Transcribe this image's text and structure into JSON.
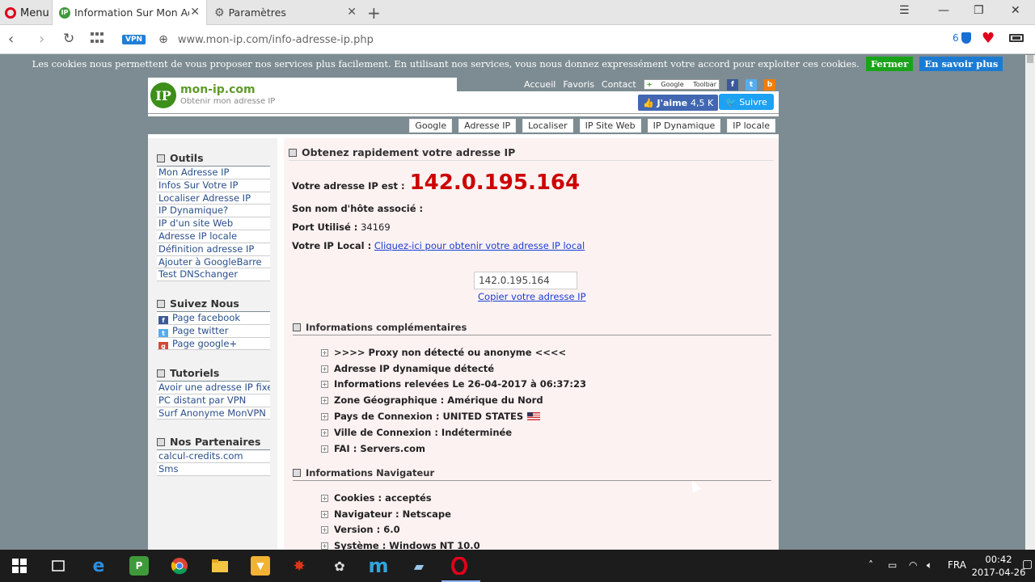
{
  "browser": {
    "menu_label": "Menu",
    "tabs": [
      {
        "title": "Information Sur Mon Adresse",
        "favicon": "IP"
      },
      {
        "title": "Paramètres",
        "favicon": "gear-icon"
      }
    ],
    "vpn_label": "VPN",
    "url": "www.mon-ip.com/info-adresse-ip.php",
    "adblock_count": "6"
  },
  "cookie_banner": {
    "text": "Les cookies nous permettent de vous proposer nos services plus facilement. En utilisant nos services, vous nous donnez expressément votre accord pour exploiter ces cookies.",
    "close_label": "Fermer",
    "more_label": "En savoir plus"
  },
  "site": {
    "logo_mark": "IP",
    "logo_title": "mon-ip.com",
    "logo_subtitle": "Obtenir mon adresse IP",
    "top_links": [
      "Accueil",
      "Favoris",
      "Contact"
    ],
    "google_toolbar": "Google",
    "google_toolbar_sub": "Toolbar",
    "like_label": "J'aime",
    "like_count": "4,5 K",
    "follow_label": "Suivre",
    "nav": [
      "Google",
      "Adresse IP",
      "Localiser",
      "IP Site Web",
      "IP Dynamique",
      "IP locale"
    ]
  },
  "sidebar": {
    "sections": [
      {
        "title": "Outils",
        "items": [
          "Mon Adresse IP",
          "Infos Sur Votre IP",
          "Localiser Adresse IP",
          "IP Dynamique?",
          "IP d'un site Web",
          "Adresse IP locale",
          "Définition adresse IP",
          "Ajouter à GoogleBarre",
          "Test DNSchanger"
        ]
      },
      {
        "title": "Suivez Nous",
        "items": [
          "Page facebook",
          "Page twitter",
          "Page google+"
        ]
      },
      {
        "title": "Tutoriels",
        "items": [
          "Avoir une adresse IP fixe",
          "PC distant par VPN",
          "Surf Anonyme MonVPN"
        ]
      },
      {
        "title": "Nos Partenaires",
        "items": [
          "calcul-credits.com",
          "Sms"
        ]
      }
    ]
  },
  "main": {
    "heading": "Obtenez rapidement votre adresse IP",
    "ip_label": "Votre adresse IP est :",
    "ip": "142.0.195.164",
    "hostname_label": "Son nom d'hôte associé :",
    "port_label": "Port Utilisé :",
    "port": "34169",
    "local_label": "Votre IP Local :",
    "local_link": "Cliquez-ici pour obtenir votre adresse IP local",
    "input_value": "142.0.195.164",
    "copy_link": "Copier votre adresse IP",
    "section1_title": "Informations complémentaires",
    "section1_items": [
      ">>>> Proxy non détecté ou anonyme <<<<",
      "Adresse IP dynamique détecté",
      "Informations relevées Le 26-04-2017 à 06:37:23",
      "Zone Géographique : Amérique du Nord",
      "Pays de Connexion : UNITED STATES",
      "Ville de Connexion : Indéterminée",
      "FAI : Servers.com"
    ],
    "section2_title": "Informations Navigateur",
    "section2_items": [
      "Cookies : acceptés",
      "Navigateur : Netscape",
      "Version : 6.0",
      "Système : Windows NT 10.0"
    ]
  },
  "taskbar": {
    "language": "FRA",
    "time": "00:42",
    "date": "2017-04-26"
  }
}
